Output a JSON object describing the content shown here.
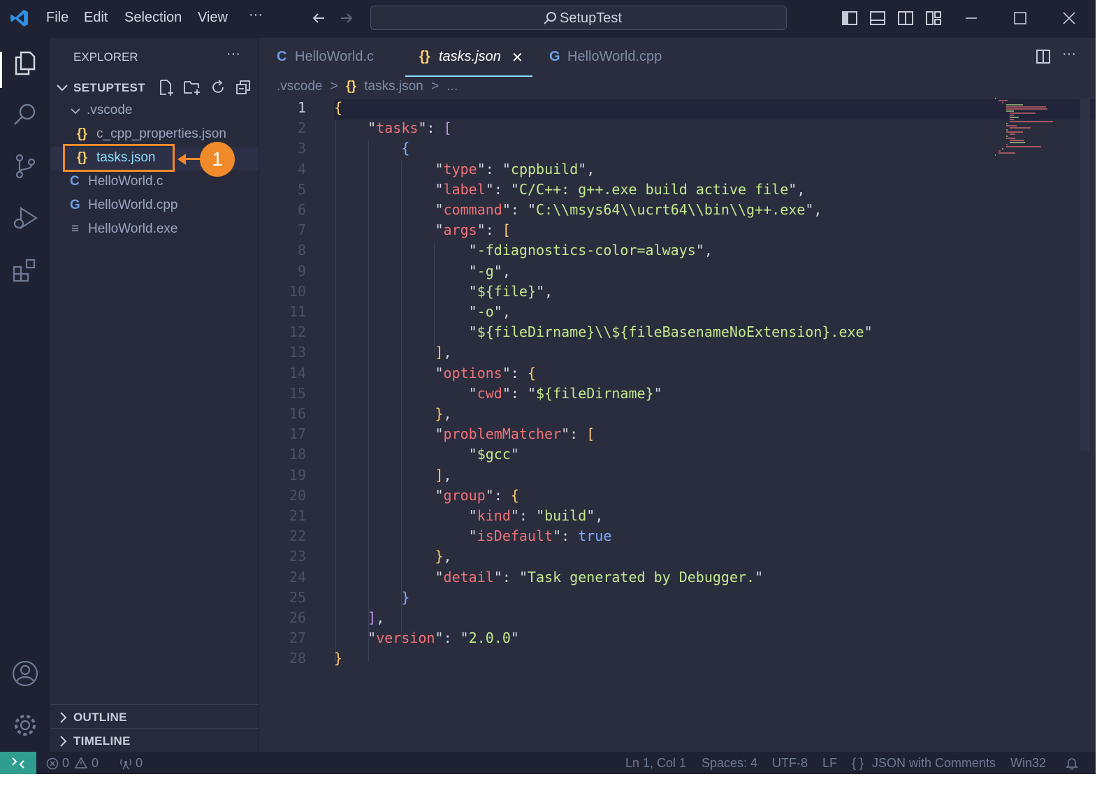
{
  "menu": {
    "file": "File",
    "edit": "Edit",
    "selection": "Selection",
    "view": "View",
    "more": "···"
  },
  "search": {
    "label": "SetupTest"
  },
  "explorer": {
    "title": "EXPLORER",
    "more": "···",
    "project": "SETUPTEST",
    "folder": ".vscode",
    "files": [
      {
        "icon": "{}",
        "label": "c_cpp_properties.json"
      },
      {
        "icon": "{}",
        "label": "tasks.json"
      },
      {
        "icon": "C",
        "label": "HelloWorld.c"
      },
      {
        "icon": "G",
        "label": "HelloWorld.cpp"
      },
      {
        "icon": "≡",
        "label": "HelloWorld.exe"
      }
    ],
    "outline": "OUTLINE",
    "timeline": "TIMELINE"
  },
  "tabs": [
    {
      "icon": "C",
      "label": "HelloWorld.c"
    },
    {
      "icon": "{}",
      "label": "tasks.json",
      "close": "✕"
    },
    {
      "icon": "G",
      "label": "HelloWorld.cpp"
    }
  ],
  "editor_more": "···",
  "breadcrumb": {
    "folder": ".vscode",
    "sep": ">",
    "icon": "{}",
    "file": "tasks.json",
    "rest": "..."
  },
  "annotation": {
    "number": "1"
  },
  "code_lines": [
    "{",
    "    \"tasks\": [",
    "        {",
    "            \"type\": \"cppbuild\",",
    "            \"label\": \"C/C++: g++.exe build active file\",",
    "            \"command\": \"C:\\\\msys64\\\\ucrt64\\\\bin\\\\g++.exe\",",
    "            \"args\": [",
    "                \"-fdiagnostics-color=always\",",
    "                \"-g\",",
    "                \"${file}\",",
    "                \"-o\",",
    "                \"${fileDirname}\\\\${fileBasenameNoExtension}.exe\"",
    "            ],",
    "            \"options\": {",
    "                \"cwd\": \"${fileDirname}\"",
    "            },",
    "            \"problemMatcher\": [",
    "                \"$gcc\"",
    "            ],",
    "            \"group\": {",
    "                \"kind\": \"build\",",
    "                \"isDefault\": true",
    "            },",
    "            \"detail\": \"Task generated by Debugger.\"",
    "        }",
    "    ],",
    "    \"version\": \"2.0.0\"",
    "}"
  ],
  "status": {
    "errors": "0",
    "warnings": "0",
    "ports": "0",
    "position": "Ln 1, Col 1",
    "spaces": "Spaces: 4",
    "encoding": "UTF-8",
    "eol": "LF",
    "language_icon": "{ }",
    "language": "JSON with Comments",
    "platform": "Win32"
  },
  "colors": {
    "accent": "#f08a2b",
    "key": "#f07178",
    "string": "#c3e88d",
    "bracket": "#ffcb6b",
    "active_tab": "#ffffff"
  }
}
